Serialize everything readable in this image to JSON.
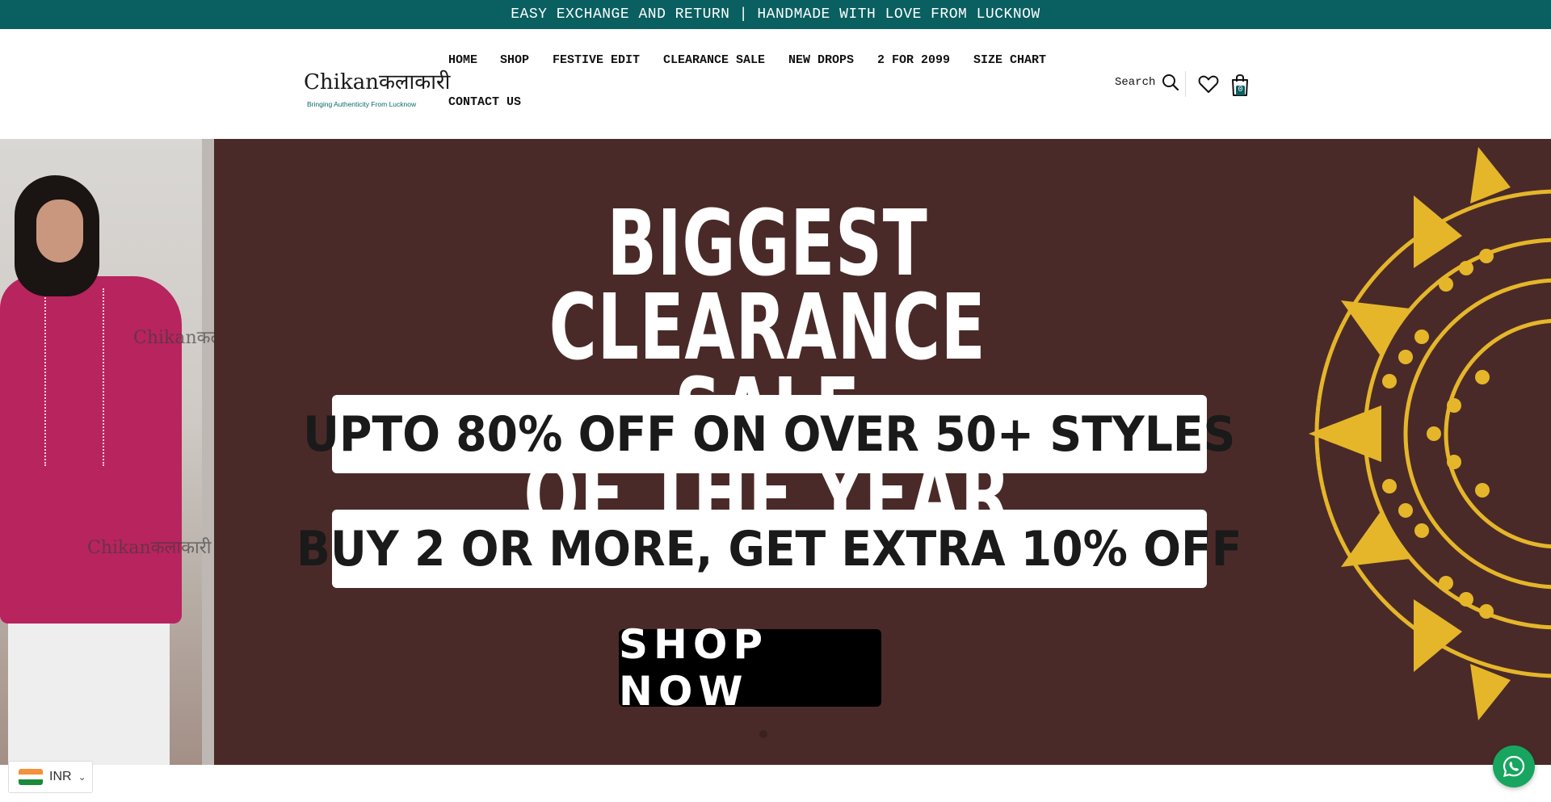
{
  "announcement": {
    "text": "EASY EXCHANGE AND RETURN | HANDMADE WITH LOVE FROM LUCKNOW⁠"
  },
  "logo": {
    "brand": "Chikanकलाकारी",
    "tagline": "Bringing Authenticity From Lucknow"
  },
  "nav": {
    "items": [
      {
        "label": "HOME"
      },
      {
        "label": "SHOP"
      },
      {
        "label": "FESTIVE EDIT"
      },
      {
        "label": "CLEARANCE SALE"
      },
      {
        "label": "NEW DROPS"
      },
      {
        "label": "2 FOR 2099"
      },
      {
        "label": "SIZE CHART"
      },
      {
        "label": "CONTACT US"
      }
    ]
  },
  "header_actions": {
    "search_label": "Search",
    "search_icon": "search-icon",
    "wishlist_icon": "heart-icon",
    "cart_icon": "shopping-bag-icon",
    "cart_count": "0"
  },
  "hero": {
    "headline_line1": "BIGGEST CLEARANCE SALE",
    "headline_line2": "OF THE YEAR",
    "offer1": "UPTO 80% OFF ON OVER 50+ STYLES",
    "offer2": "BUY 2 OR MORE, GET EXTRA 10% OFF",
    "cta": "SHOP NOW",
    "watermark": "Chikanकलाकारी",
    "background_color": "#4a2a28",
    "mandala_color": "#e5b62a"
  },
  "currency": {
    "code": "INR",
    "flag_icon": "india-flag-icon"
  },
  "colors": {
    "brand_teal": "#0a5f60",
    "whatsapp_green": "#18a55f"
  },
  "whatsapp": {
    "icon": "whatsapp-icon"
  }
}
